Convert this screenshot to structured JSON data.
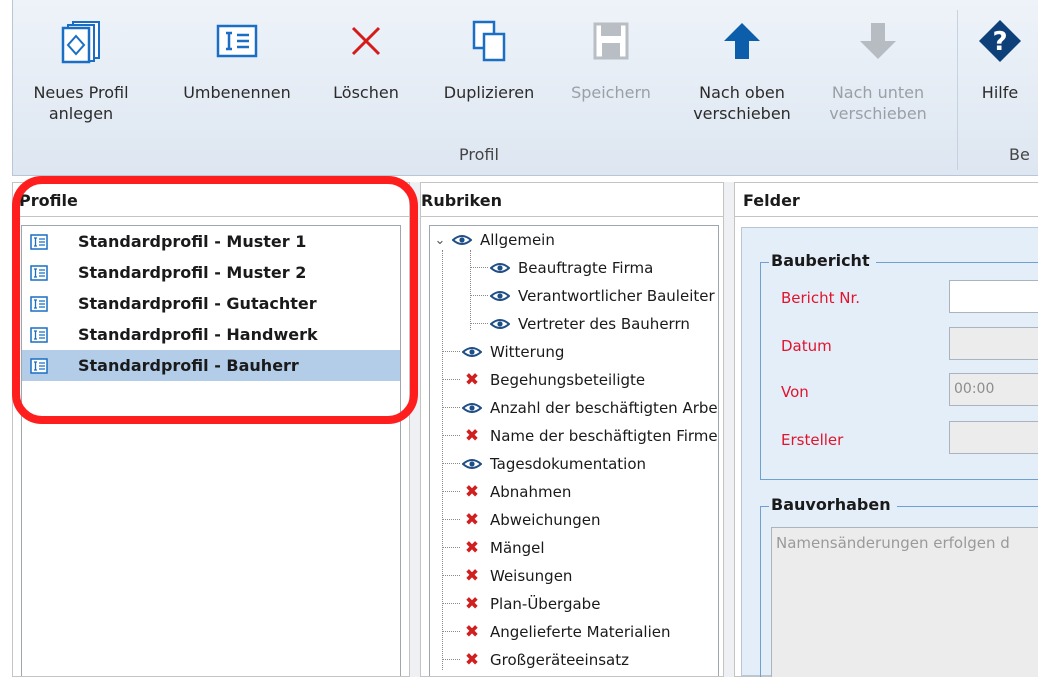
{
  "ribbon": {
    "buttons": [
      {
        "label": "Neues Profil\nanlegen",
        "icon": "new-profile-icon",
        "enabled": true
      },
      {
        "label": "Umbenennen",
        "icon": "rename-icon",
        "enabled": true
      },
      {
        "label": "Löschen",
        "icon": "delete-icon",
        "enabled": true
      },
      {
        "label": "Duplizieren",
        "icon": "duplicate-icon",
        "enabled": true
      },
      {
        "label": "Speichern",
        "icon": "save-icon",
        "enabled": false
      },
      {
        "label": "Nach oben\nverschieben",
        "icon": "arrow-up-icon",
        "enabled": true
      },
      {
        "label": "Nach unten\nverschieben",
        "icon": "arrow-down-icon",
        "enabled": false
      },
      {
        "label": "Hilfe",
        "icon": "help-icon",
        "enabled": true
      }
    ],
    "groups": {
      "profil": "Profil",
      "second": "Be"
    }
  },
  "panels": {
    "profile": {
      "title": "Profile"
    },
    "rubriken": {
      "title": "Rubriken"
    },
    "felder": {
      "title": "Felder"
    }
  },
  "profiles": [
    {
      "label": "Standardprofil - Muster 1",
      "selected": false
    },
    {
      "label": "Standardprofil - Muster 2",
      "selected": false
    },
    {
      "label": "Standardprofil - Gutachter",
      "selected": false
    },
    {
      "label": "Standardprofil - Handwerk",
      "selected": false
    },
    {
      "label": "Standardprofil - Bauherr",
      "selected": true
    }
  ],
  "rubriken": {
    "parent": {
      "label": "Allgemein",
      "state": "visible",
      "expanded": true
    },
    "children": [
      {
        "label": "Beauftragte Firma",
        "state": "visible"
      },
      {
        "label": "Verantwortlicher Bauleiter",
        "state": "visible"
      },
      {
        "label": "Vertreter des Bauherrn",
        "state": "visible"
      }
    ],
    "items": [
      {
        "label": "Witterung",
        "state": "visible"
      },
      {
        "label": "Begehungsbeteiligte",
        "state": "hidden"
      },
      {
        "label": "Anzahl der beschäftigten Arbeitskräfte",
        "state": "visible"
      },
      {
        "label": "Name der beschäftigten Firmen",
        "state": "hidden"
      },
      {
        "label": "Tagesdokumentation",
        "state": "visible"
      },
      {
        "label": "Abnahmen",
        "state": "hidden"
      },
      {
        "label": "Abweichungen",
        "state": "hidden"
      },
      {
        "label": "Mängel",
        "state": "hidden"
      },
      {
        "label": "Weisungen",
        "state": "hidden"
      },
      {
        "label": "Plan-Übergabe",
        "state": "hidden"
      },
      {
        "label": "Angelieferte Materialien",
        "state": "hidden"
      },
      {
        "label": "Großgeräteeinsatz",
        "state": "hidden"
      }
    ]
  },
  "felder": {
    "baubericht": {
      "legend": "Baubericht",
      "fields": [
        {
          "label": "Bericht Nr.",
          "value": "",
          "editable": true
        },
        {
          "label": "Datum",
          "value": "",
          "editable": false
        },
        {
          "label": "Von",
          "value": "00:00",
          "editable": false
        },
        {
          "label": "Ersteller",
          "value": "",
          "editable": false
        }
      ]
    },
    "bauvorhaben": {
      "legend": "Bauvorhaben",
      "placeholder": "Namensänderungen erfolgen d"
    }
  },
  "colors": {
    "highlight": "#ff1e1e",
    "selection": "#b3cde9",
    "required_label": "#e0142d",
    "icon_blue": "#1a6fc4"
  }
}
